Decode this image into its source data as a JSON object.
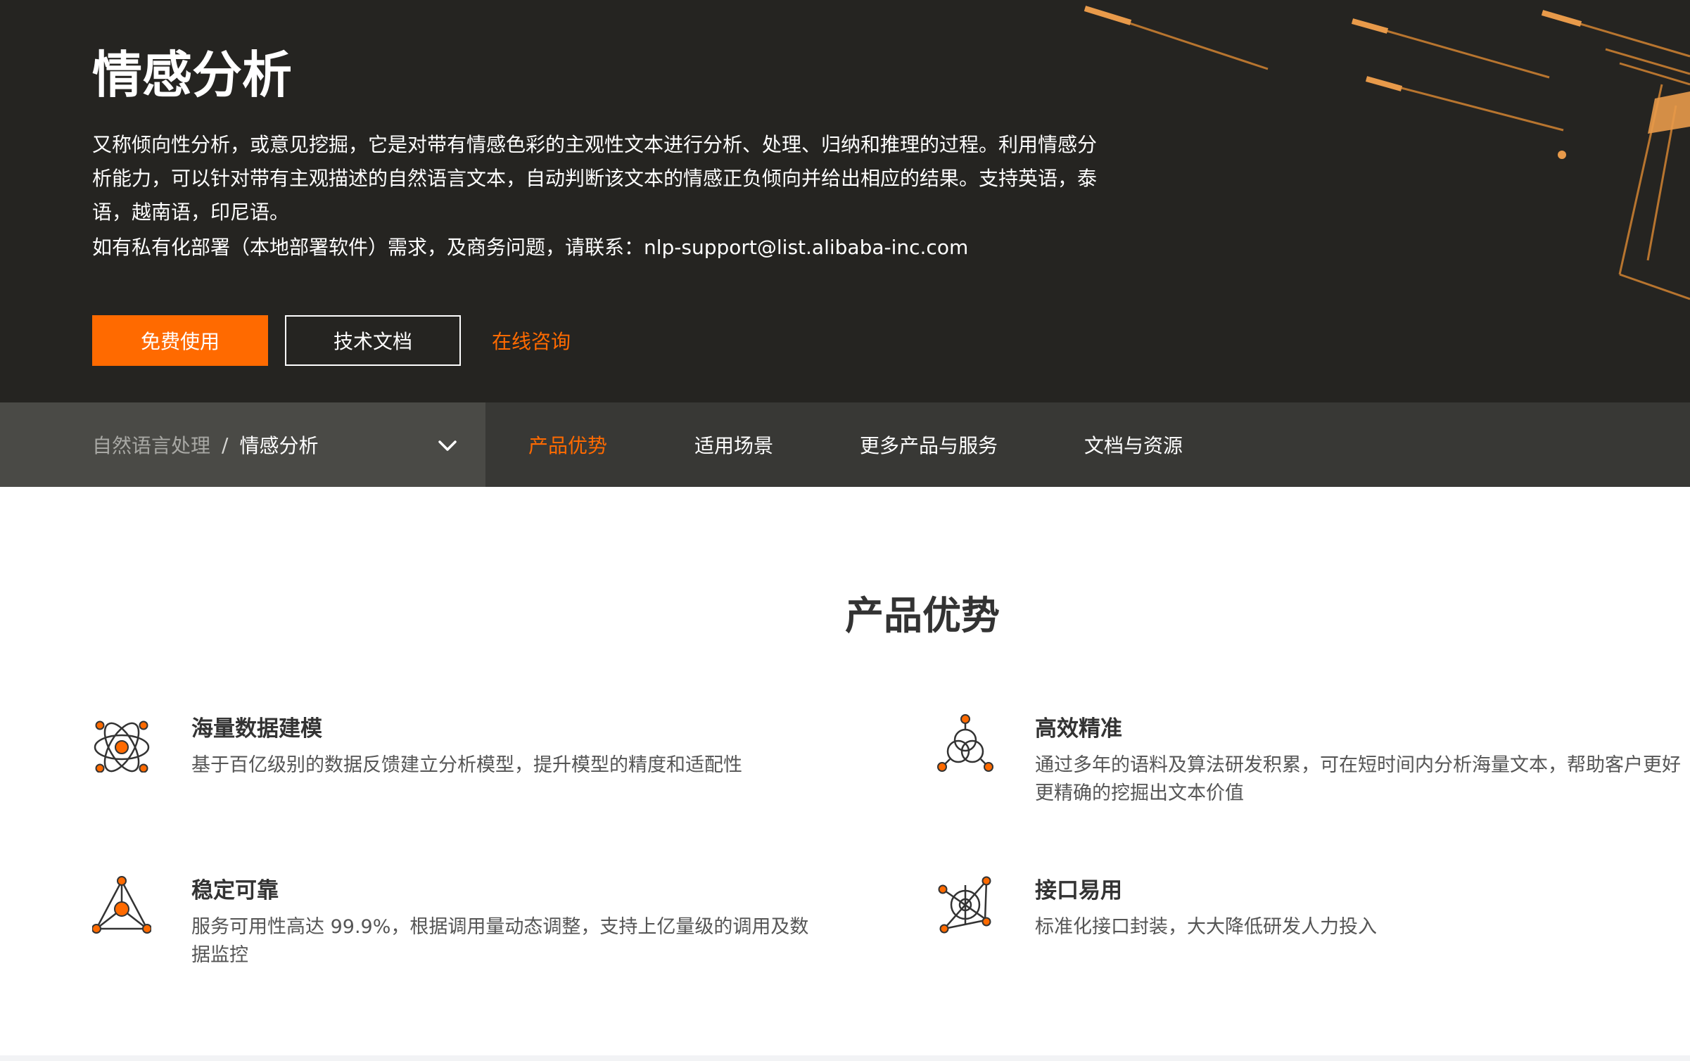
{
  "colors": {
    "accent": "#ff6a00",
    "hero_bg": "#252421",
    "nav_bg": "#383835",
    "nav_left_bg": "#4a4a46",
    "gold": "#b8752f"
  },
  "hero": {
    "title": "情感分析",
    "description": "又称倾向性分析，或意见挖掘，它是对带有情感色彩的主观性文本进行分析、处理、归纳和推理的过程。利用情感分析能力，可以针对带有主观描述的自然语言文本，自动判断该文本的情感正负倾向并给出相应的结果。支持英语，泰语，越南语，印尼语。",
    "contact": "如有私有化部署（本地部署软件）需求，及商务问题，请联系：nlp-support@list.alibaba-inc.com",
    "buttons": {
      "free_use": "免费使用",
      "tech_docs": "技术文档",
      "online_consult": "在线咨询"
    }
  },
  "nav": {
    "breadcrumb": {
      "parent": "自然语言处理",
      "separator": "/",
      "current": "情感分析"
    },
    "tabs": [
      {
        "label": "产品优势",
        "active": true
      },
      {
        "label": "适用场景",
        "active": false
      },
      {
        "label": "更多产品与服务",
        "active": false
      },
      {
        "label": "文档与资源",
        "active": false
      }
    ]
  },
  "advantages": {
    "title": "产品优势",
    "items": [
      {
        "icon": "atom-icon",
        "title": "海量数据建模",
        "desc": "基于百亿级别的数据反馈建立分析模型，提升模型的精度和适配性"
      },
      {
        "icon": "venn-circles-icon",
        "title": "高效精准",
        "desc": "通过多年的语料及算法研发积累，可在短时间内分析海量文本，帮助客户更好更精确的挖掘出文本价值"
      },
      {
        "icon": "triangle-network-icon",
        "title": "稳定可靠",
        "desc": "服务可用性高达 99.9%，根据调用量动态调整，支持上亿量级的调用及数据监控"
      },
      {
        "icon": "target-network-icon",
        "title": "接口易用",
        "desc": "标准化接口封装，大大降低研发人力投入"
      }
    ]
  }
}
